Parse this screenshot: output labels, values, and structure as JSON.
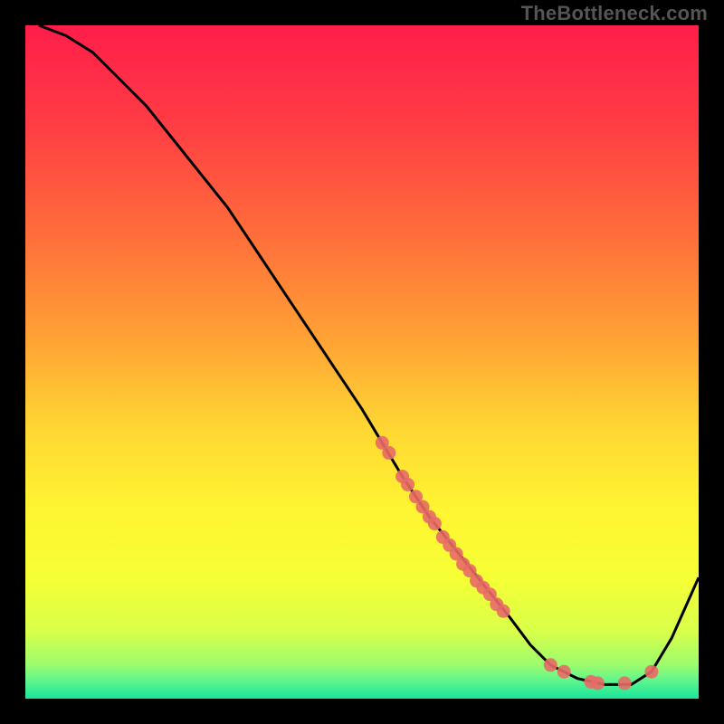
{
  "attribution": "TheBottleneck.com",
  "chart_data": {
    "type": "line",
    "title": "",
    "xlabel": "",
    "ylabel": "",
    "xlim": [
      0,
      100
    ],
    "ylim": [
      0,
      100
    ],
    "series": [
      {
        "name": "curve",
        "x": [
          2,
          6,
          10,
          14,
          18,
          22,
          26,
          30,
          34,
          38,
          42,
          46,
          50,
          53,
          56,
          60,
          64,
          68,
          72,
          75,
          78,
          82,
          86,
          90,
          93,
          96,
          100
        ],
        "y": [
          100,
          98.5,
          96,
          92,
          88,
          83,
          78,
          73,
          67,
          61,
          55,
          49,
          43,
          38,
          33,
          27,
          22,
          17,
          12,
          8,
          5,
          3,
          2.1,
          2.1,
          4,
          9,
          18
        ]
      }
    ],
    "markers": {
      "name": "highlighted-points",
      "color": "#e86a66",
      "points": [
        {
          "x": 53,
          "y": 38
        },
        {
          "x": 54,
          "y": 36.5
        },
        {
          "x": 56,
          "y": 33
        },
        {
          "x": 56.8,
          "y": 31.8
        },
        {
          "x": 58,
          "y": 30
        },
        {
          "x": 59,
          "y": 28.5
        },
        {
          "x": 60,
          "y": 27
        },
        {
          "x": 60.8,
          "y": 26
        },
        {
          "x": 62,
          "y": 24
        },
        {
          "x": 63,
          "y": 22.8
        },
        {
          "x": 64,
          "y": 21.5
        },
        {
          "x": 65,
          "y": 20
        },
        {
          "x": 66,
          "y": 19
        },
        {
          "x": 67,
          "y": 17.5
        },
        {
          "x": 68,
          "y": 16.5
        },
        {
          "x": 69,
          "y": 15.5
        },
        {
          "x": 70,
          "y": 14
        },
        {
          "x": 71,
          "y": 13
        },
        {
          "x": 78,
          "y": 5
        },
        {
          "x": 80,
          "y": 4
        },
        {
          "x": 84,
          "y": 2.5
        },
        {
          "x": 85,
          "y": 2.3
        },
        {
          "x": 89,
          "y": 2.3
        },
        {
          "x": 93,
          "y": 4
        }
      ]
    },
    "background_gradient": {
      "stops": [
        {
          "offset": 0.0,
          "color": "#ff1d4a"
        },
        {
          "offset": 0.14,
          "color": "#ff3b45"
        },
        {
          "offset": 0.3,
          "color": "#ff6a3b"
        },
        {
          "offset": 0.46,
          "color": "#ffa035"
        },
        {
          "offset": 0.6,
          "color": "#ffd733"
        },
        {
          "offset": 0.72,
          "color": "#fff531"
        },
        {
          "offset": 0.82,
          "color": "#f6ff35"
        },
        {
          "offset": 0.9,
          "color": "#d9ff49"
        },
        {
          "offset": 0.95,
          "color": "#9cfc6e"
        },
        {
          "offset": 0.975,
          "color": "#5af58f"
        },
        {
          "offset": 1.0,
          "color": "#18e59a"
        }
      ]
    }
  }
}
